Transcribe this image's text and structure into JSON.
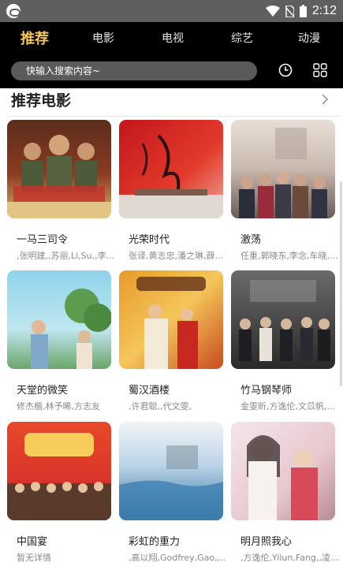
{
  "status_bar": {
    "time": "2:12",
    "icons": [
      "app-logo-icon",
      "wifi-icon",
      "no-sim-icon",
      "battery-icon"
    ]
  },
  "nav": {
    "tabs": [
      {
        "label": "推荐",
        "active": true
      },
      {
        "label": "电影",
        "active": false
      },
      {
        "label": "电视",
        "active": false
      },
      {
        "label": "综艺",
        "active": false
      },
      {
        "label": "动漫",
        "active": false
      }
    ],
    "search_placeholder": "快输入搜索内容~",
    "history_icon": "clock-icon",
    "grid_icon": "grid-icon"
  },
  "section": {
    "title": "推荐电影",
    "more_icon": "chevron-right-icon"
  },
  "movies": [
    {
      "title": "一马三司令",
      "cast": ",张明建,,苏丽,Li,Su,,李..."
    },
    {
      "title": "光荣时代",
      "cast": "张译,黄志忠,潘之琳,薛..."
    },
    {
      "title": "激荡",
      "cast": "任重,郭晓东,李念,车晓,..."
    },
    {
      "title": "天堂的微笑",
      "cast": "修杰楷,林予晞,方志友"
    },
    {
      "title": "蜀汉酒楼",
      "cast": ",许君聪,,代文雯,"
    },
    {
      "title": "竹马钢琴师",
      "cast": "金雯昕,方逸伦,文苡帆,..."
    },
    {
      "title": "中国宴",
      "cast": "暂无详情"
    },
    {
      "title": "彩虹的重力",
      "cast": ",高以翔,Godfrey,Gao,,..."
    },
    {
      "title": "明月照我心",
      "cast": ",方逸伦,Yilun,Fang,,凌..."
    }
  ],
  "colors": {
    "accent": "#f5c65a",
    "header_bg": "#000000",
    "status_bg": "#5f5f5f"
  }
}
